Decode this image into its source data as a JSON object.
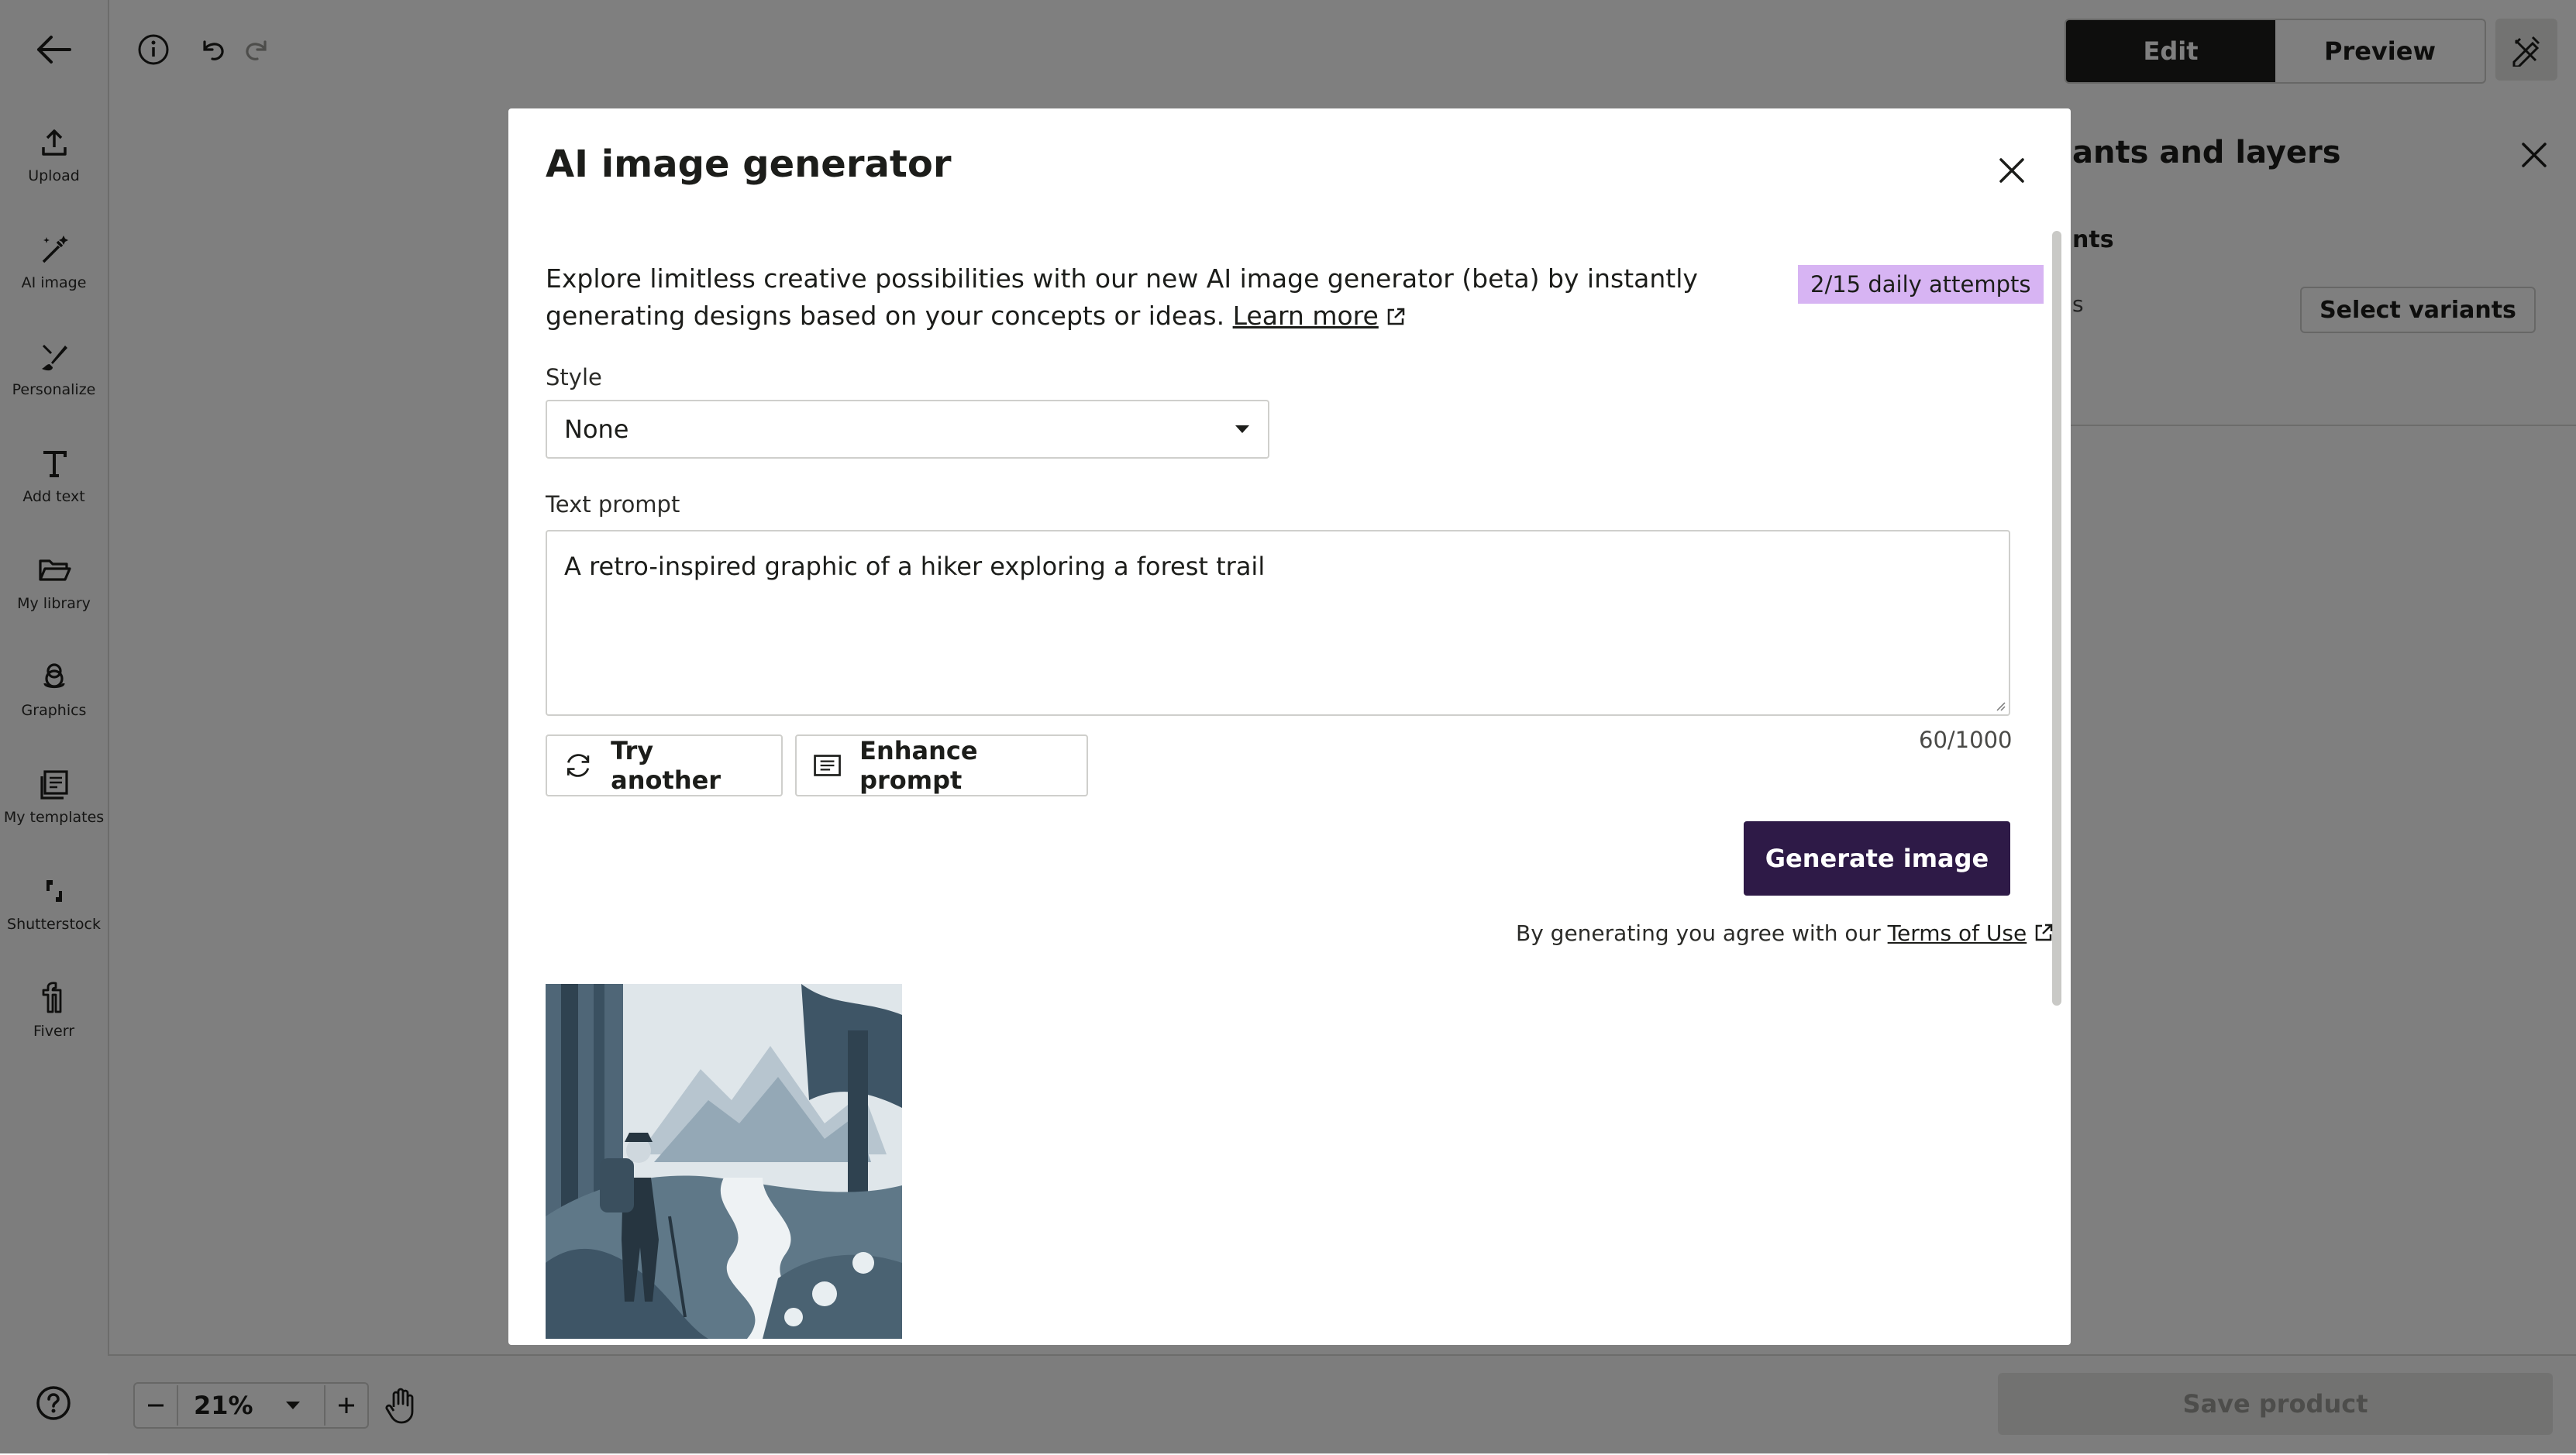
{
  "rail": {
    "items": [
      {
        "label": "Upload",
        "icon": "upload-icon"
      },
      {
        "label": "AI image",
        "icon": "magic-wand-icon"
      },
      {
        "label": "Personalize",
        "icon": "brush-icon"
      },
      {
        "label": "Add text",
        "icon": "text-icon"
      },
      {
        "label": "My library",
        "icon": "folder-icon"
      },
      {
        "label": "Graphics",
        "icon": "graphics-icon"
      },
      {
        "label": "My templates",
        "icon": "templates-icon"
      },
      {
        "label": "Shutterstock",
        "icon": "shutterstock-icon"
      },
      {
        "label": "Fiverr",
        "icon": "fiverr-icon"
      }
    ]
  },
  "header": {
    "edit_label": "Edit",
    "preview_label": "Preview"
  },
  "right_panel": {
    "title_fragment": "ants and layers",
    "sub_fragment": "nts",
    "sub2_fragment": "s",
    "select_variants_label": "Select variants"
  },
  "footer": {
    "zoom_value": "21%",
    "save_label": "Save product"
  },
  "modal": {
    "title": "AI image generator",
    "intro_text": "Explore limitless creative possibilities with our new AI image generator (beta) by instantly generating designs based on your concepts or ideas.",
    "learn_more_label": "Learn more",
    "attempts_badge": "2/15 daily attempts",
    "style_label": "Style",
    "style_value": "None",
    "prompt_label": "Text prompt",
    "prompt_value": "A retro-inspired graphic of a hiker exploring a forest trail",
    "char_count": "60/1000",
    "try_another_label": "Try another",
    "enhance_prompt_label": "Enhance prompt",
    "generate_label": "Generate image",
    "terms_prefix": "By generating you agree with our",
    "terms_link_label": "Terms of Use"
  },
  "colors": {
    "generate_button": "#2e1a47",
    "attempts_badge_bg": "#d7b4f3",
    "overlay": "rgba(0,0,0,0.5)"
  }
}
